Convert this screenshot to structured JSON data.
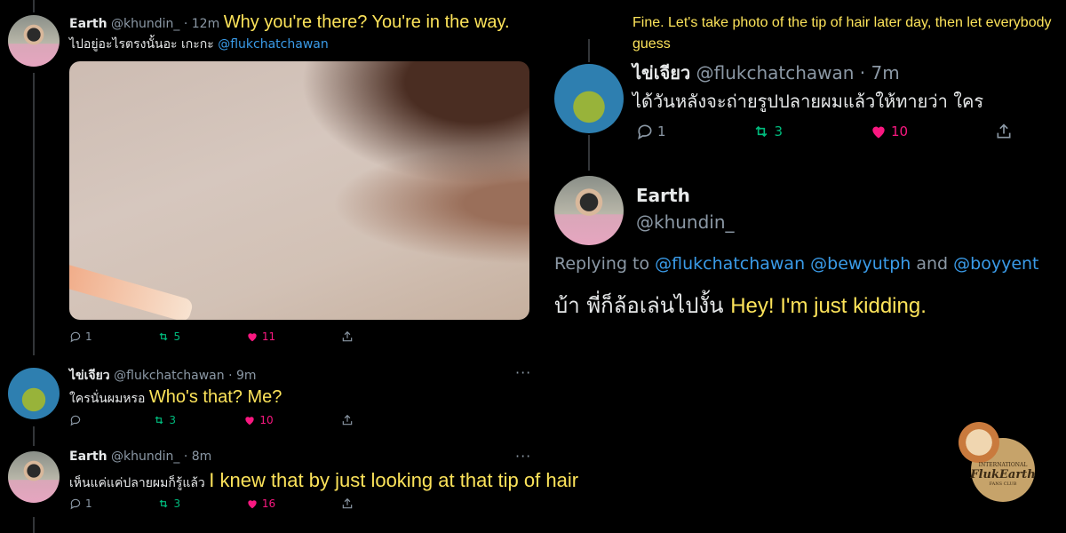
{
  "left": {
    "tweet1": {
      "name": "Earth",
      "handle": "@khundin_",
      "time": "· 12m",
      "caption": "Why you're there? You're in the way.",
      "text": "ไปอยู่อะไรตรงนั้นอะ เกะกะ",
      "mention": "@flukchatchawan",
      "replies": "1",
      "retweets": "5",
      "likes": "11"
    },
    "tweet2": {
      "name": "ไข่เจียว",
      "handle": "@flukchatchawan",
      "time": "· 9m",
      "text": "ใครนั่นผมหรอ",
      "caption": "Who's that? Me?",
      "replies": "",
      "retweets": "3",
      "likes": "10",
      "more": "···"
    },
    "tweet3": {
      "name": "Earth",
      "handle": "@khundin_",
      "time": "· 8m",
      "text": "เห็นแค่แค่ปลายผมก็รู้แล้ว",
      "caption": "I knew that by just looking at that tip of hair",
      "replies": "1",
      "retweets": "3",
      "likes": "16",
      "more": "···"
    }
  },
  "right": {
    "caption_top": "Fine. Let's take photo of the tip of hair later day, then let everybody guess",
    "tweet": {
      "name": "ไข่เจียว",
      "handle": "@flukchatchawan",
      "time": "· 7m",
      "text": "ได้วันหลังจะถ่ายรูปปลายผมแล้วให้ทายว่า ใคร",
      "replies": "1",
      "retweets": "3",
      "likes": "10"
    },
    "reply": {
      "name": "Earth",
      "handle": "@khundin_",
      "replying_prefix": "Replying to",
      "mention1": "@flukchatchawan",
      "mention2": "@bewyutph",
      "and": "and",
      "mention3": "@boyyent",
      "text": "บ้า พี่ก็ล้อเล่นไปงั้น",
      "caption": "Hey! I'm just kidding."
    }
  },
  "logo": {
    "line1": "INTERNATIONAL",
    "line2": "FlukEarth",
    "line3": "FANS CLUB"
  },
  "colors": {
    "caption": "#fce35a",
    "mention": "#3a9be8",
    "retweet": "#00ba7c",
    "like": "#f91880"
  }
}
